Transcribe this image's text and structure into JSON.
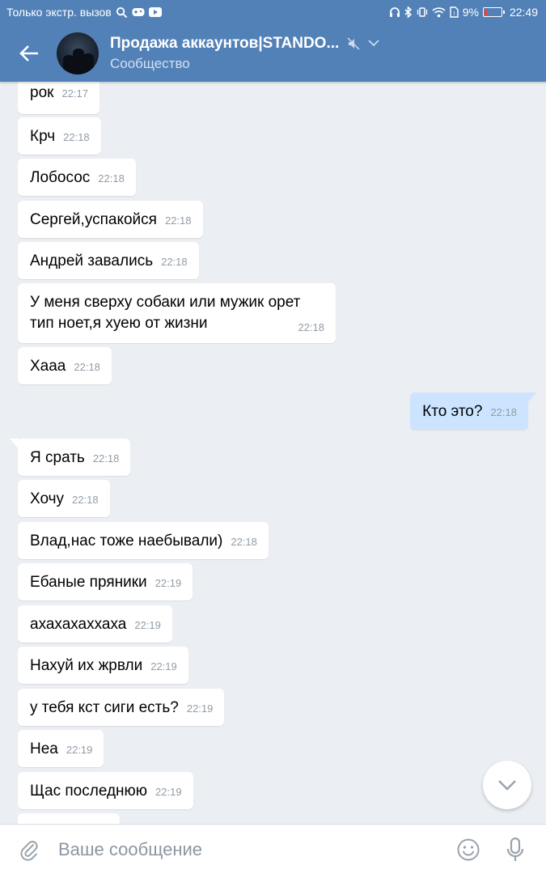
{
  "status": {
    "carrier": "Только экстр. вызов",
    "battery": "9%",
    "time": "22:49"
  },
  "header": {
    "title": "Продажа аккаунтов|STANDO...",
    "subtitle": "Сообщество"
  },
  "messages": [
    {
      "text": "рок",
      "time": "22:17"
    },
    {
      "text": "Крч",
      "time": "22:18"
    },
    {
      "text": "Лобосос",
      "time": "22:18"
    },
    {
      "text": "Сергей,успакойся",
      "time": "22:18"
    },
    {
      "text": "Андрей завались",
      "time": "22:18"
    },
    {
      "line1": "У меня сверху собаки или мужик орет",
      "line2": "тип ноет,я хуею от жизни",
      "time": "22:18"
    },
    {
      "text": "Хааа",
      "time": "22:18"
    },
    {
      "text": "Кто это?",
      "time": "22:18",
      "outgoing": true
    },
    {
      "text": "Я срать",
      "time": "22:18"
    },
    {
      "text": "Хочу",
      "time": "22:18"
    },
    {
      "text": "Влад,нас тоже наебывали)",
      "time": "22:18"
    },
    {
      "text": "Ебаные пряники",
      "time": "22:19"
    },
    {
      "text": "ахахахаххаха",
      "time": "22:19"
    },
    {
      "text": "Нахуй их жрвли",
      "time": "22:19"
    },
    {
      "text": "у тебя кст сиги есть?",
      "time": "22:19"
    },
    {
      "text": "Неа",
      "time": "22:19"
    },
    {
      "text": "Щас последнюю",
      "time": "22:19"
    }
  ],
  "input": {
    "placeholder": "Ваше сообщение"
  },
  "colors": {
    "header": "#5281b8",
    "background": "#ebeef2",
    "outgoing_bubble": "#cce4ff"
  }
}
